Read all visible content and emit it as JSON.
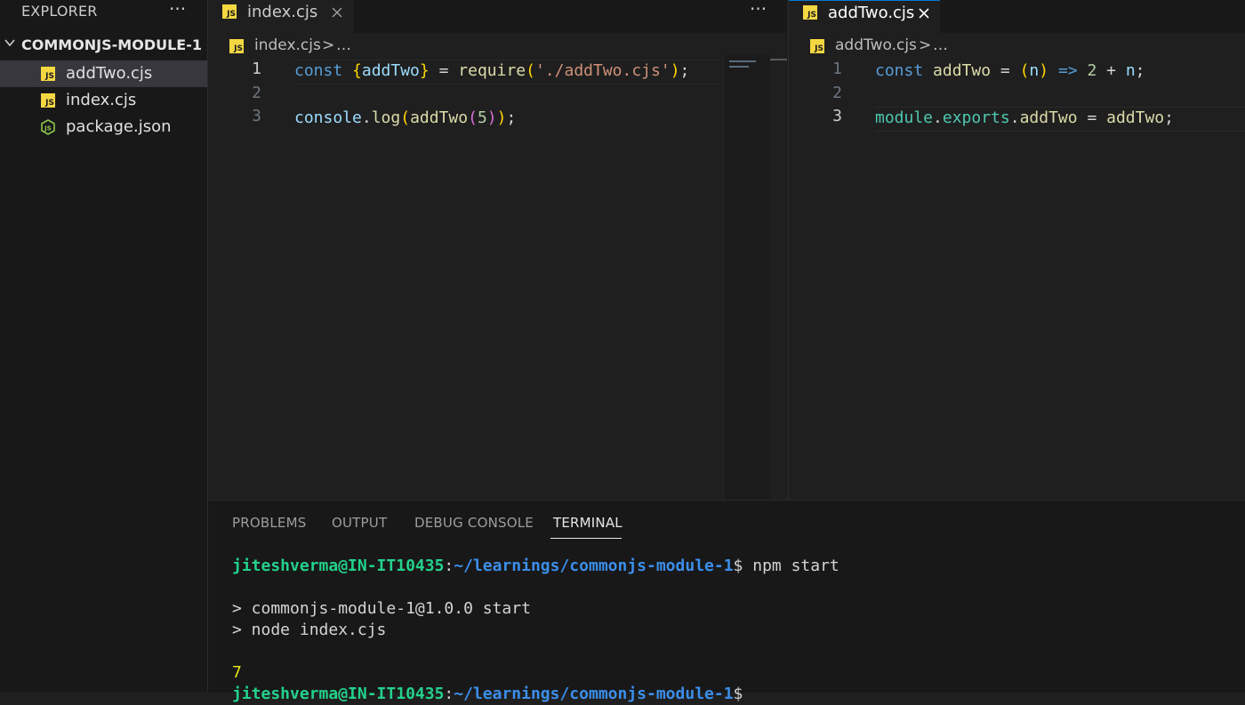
{
  "sidebar": {
    "title": "EXPLORER",
    "more": "···",
    "folder": "COMMONJS-MODULE-1",
    "files": [
      {
        "name": "addTwo.cjs",
        "icon": "js-file-icon",
        "selected": true
      },
      {
        "name": "index.cjs",
        "icon": "js-file-icon",
        "selected": false
      },
      {
        "name": "package.json",
        "icon": "node-file-icon",
        "selected": false
      }
    ]
  },
  "editor_left": {
    "tab_label": "index.cjs",
    "more": "···",
    "breadcrumb": {
      "file": "index.cjs",
      "sep": ">",
      "more": "…"
    },
    "line_numbers": [
      "1",
      "2",
      "3"
    ],
    "code": {
      "l1": {
        "kw": "const",
        "b_open": "{",
        "var": "addTwo",
        "b_close": "}",
        "eq": " = ",
        "fn": "require",
        "p_open": "(",
        "str": "'./addTwo.cjs'",
        "p_close": ")",
        "semi": ";"
      },
      "l3": {
        "obj": "console",
        "dot": ".",
        "fn": "log",
        "p_open": "(",
        "fn2": "addTwo",
        "p2_open": "(",
        "num": "5",
        "p2_close": ")",
        "p_close": ")",
        "semi": ";"
      }
    }
  },
  "editor_right": {
    "tab_label": "addTwo.cjs",
    "breadcrumb": {
      "file": "addTwo.cjs",
      "sep": ">",
      "more": "…"
    },
    "line_numbers": [
      "1",
      "2",
      "3"
    ],
    "code": {
      "l1": {
        "kw": "const",
        "fn": "addTwo",
        "eq": " = ",
        "p_open": "(",
        "param": "n",
        "p_close": ")",
        "arrow": " => ",
        "num": "2",
        "plus": " + ",
        "var": "n",
        "semi": ";"
      },
      "l3": {
        "mod": "module",
        "dot1": ".",
        "exp": "exports",
        "dot2": ".",
        "prop": "addTwo",
        "eq": " = ",
        "val": "addTwo",
        "semi": ";"
      }
    }
  },
  "panel": {
    "tabs": [
      "PROBLEMS",
      "OUTPUT",
      "DEBUG CONSOLE",
      "TERMINAL"
    ],
    "active_tab": "TERMINAL",
    "terminal": {
      "user": "jiteshverma@IN-IT10435",
      "colon": ":",
      "path": "~/learnings/commonjs-module-1",
      "prompt": "$ ",
      "command": "npm start",
      "out1": "> commonjs-module-1@1.0.0 start",
      "out2": "> node index.cjs",
      "result": "7",
      "prompt_end": "$"
    }
  },
  "colors": {
    "background": "#1f1f1f",
    "sidebar": "#181818",
    "selected_row": "#37373d",
    "js_badge": "#f5d742",
    "terminal_user": "#23d18b",
    "terminal_path": "#3b8eea",
    "terminal_output": "#e5e510"
  }
}
